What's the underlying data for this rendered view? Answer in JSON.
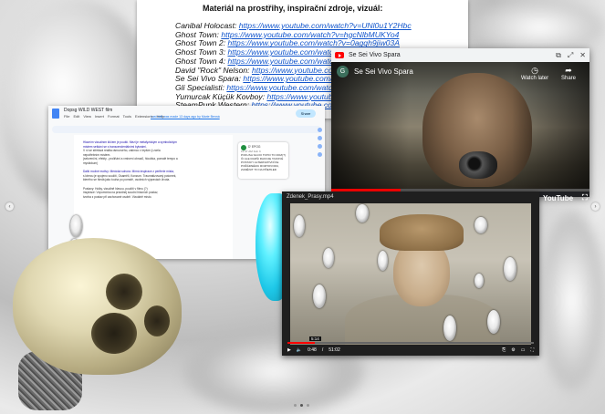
{
  "doc_back": {
    "heading": "Materiál na prostřihy, inspirační zdroje, vizuál:",
    "lines": [
      {
        "label": "Canibal Holocast: ",
        "url": "https://www.youtube.com/watch?v=UNl0u1Y2Hbc"
      },
      {
        "label": "Ghost Town: ",
        "url": "https://www.youtube.com/watch?v=hgcNlbMUKYo4"
      },
      {
        "label": "Ghost Town 2: ",
        "url": "https://www.youtube.com/watch?v=0agqh9jiw03A"
      },
      {
        "label": "Ghost Town 3: ",
        "url": "https://www.youtube.com/watch?v=cfyBt"
      },
      {
        "label": "Ghost Town 4: ",
        "url": "https://www.youtube.com/watch?v=vZLi"
      },
      {
        "label": "David \"Rock\" Nelson: ",
        "url": "https://www.youtube.com/watch?v="
      },
      {
        "label": "Se Sei Vivo Spara: ",
        "url": "https://www.youtube.com/watch?v="
      },
      {
        "label": "Gli Specialisti: ",
        "url": "https://www.youtube.com/watch?v=cmbs"
      },
      {
        "label": "Yumurcak Küçük Kovboy: ",
        "url": "https://www.youtube.com/watch"
      },
      {
        "label": "SteamPunk Western: ",
        "url": "https://www.youtube.com/watch?v="
      }
    ]
  },
  "youtube_popup": {
    "title": "Se Sei Vivo Spara",
    "overlay_title": "Se Sei Vivo Spara",
    "channel_initial": "G",
    "watch_later": "Watch later",
    "share": "Share",
    "progress_fraction": 0.27,
    "brand_color": "#ff0000"
  },
  "gdoc": {
    "title": "Dopsg WILD WEST film",
    "menus": [
      "File",
      "Edit",
      "View",
      "Insert",
      "Format",
      "Tools",
      "Extensions",
      "Help"
    ],
    "last_edit": "Last edit was made 13 days ago by Marie Benná",
    "share_label": "Share",
    "page_lines": [
      "Hlavním vizuálním klíčem je pouští. Mezi je metafyzickým a symbolickým",
      "místem setkání se s transcendentálními bytostmi.",
      "V ní se střetává realita rámcového, zatímco v lepším ji zcela",
      "nepotřebním místem.",
      "(sekvenční, efekty - proliňání a vrstvení obrazů, hloubka, pomalé tempo a",
      "mystickum)",
      "",
      "Další možné motivy: Mexická sohora. Mírná inspirace z periferie místa,",
      "s kterou je spojeno soužití, Osamělí, Konzum. Traumatizovaný potomek,",
      "kterého se hledá jako touha po pomstě, osobních výpravách života.",
      "",
      "Postavy: Holky, vizuálně hlavou. použití v filmu (?)",
      "inspirace: Vzpomínka na prázdnej soudní hlavních postav,",
      "tvorba z postav při zachované osobě. Vizuálně místo."
    ],
    "comment": {
      "author": "D' EPOG",
      "time": "11:47 AM Feb 3",
      "text": "POKUSA SA DO TOHO TO ROZ(?) ČI ALE RADŠI RAKOJE TAKOVÉ POSTAVY ALTERNATIVNÍ KE POŘÁDNÉMU ROZHOVORU, ZAMĚNIT TO NA PŘEHLED"
    }
  },
  "video_window": {
    "filename": "Zdenek_Prasy.mp4",
    "time_current": "0:48",
    "time_total": "51:02",
    "hover_time": "5:14",
    "progress_fraction": 0.11,
    "brand": "YouTube"
  },
  "page_dots": {
    "count": 3,
    "active": 1
  },
  "accent_blue": "#1ec8e8"
}
